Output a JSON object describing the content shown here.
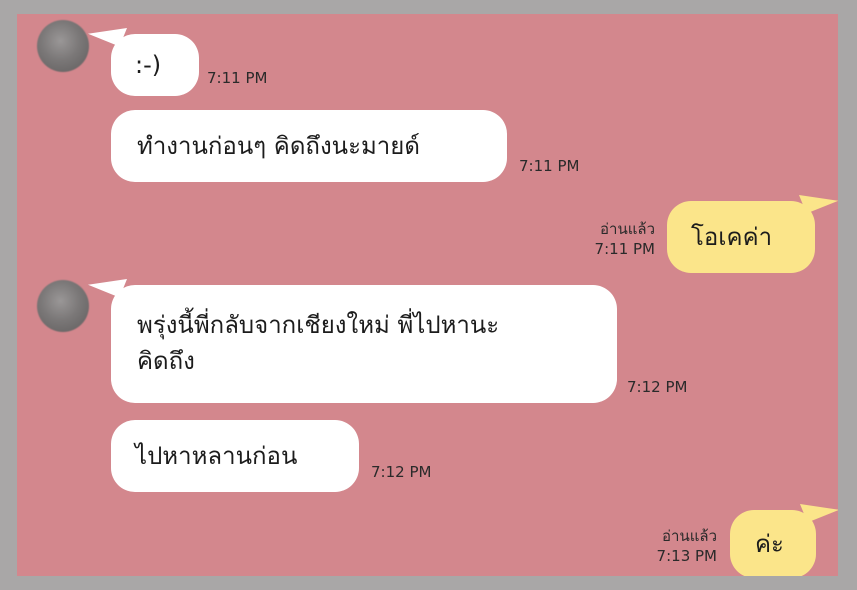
{
  "messages": [
    {
      "text": ":-)",
      "time": "7:11 PM"
    },
    {
      "text": "ทำงานก่อนๆ คิดถึงนะมายด์",
      "time": "7:11 PM"
    },
    {
      "text": "โอเคค่า",
      "time": "7:11 PM",
      "read": "อ่านแล้ว"
    },
    {
      "line1": "พรุ่งนี้พี่กลับจากเชียงใหม่ พี่ไปหานะ",
      "line2": "คิดถึง",
      "time": "7:12 PM"
    },
    {
      "text": "ไปหาหลานก่อน",
      "time": "7:12 PM"
    },
    {
      "text": "ค่ะ",
      "time": "7:13 PM",
      "read": "อ่านแล้ว"
    }
  ],
  "colors": {
    "background": "#d3878d",
    "incoming_bubble": "#ffffff",
    "outgoing_bubble": "#fbe58a"
  }
}
